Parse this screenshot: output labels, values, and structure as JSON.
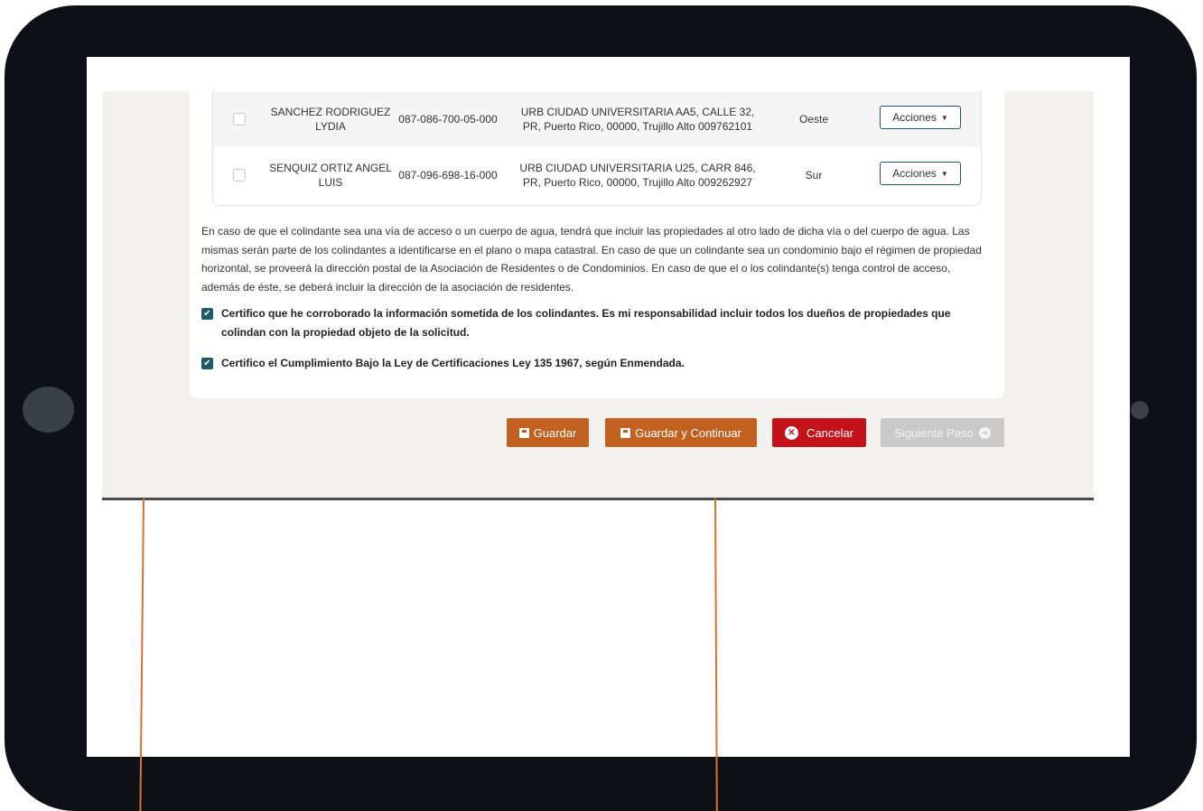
{
  "table": {
    "rows": [
      {
        "name": "SANCHEZ RODRIGUEZ LYDIA",
        "number": "087-086-700-05-000",
        "address": "URB CIUDAD UNIVERSITARIA AA5, CALLE 32, PR, Puerto Rico, 00000, Trujillo Alto 009762101",
        "direction": "Oeste",
        "actions_label": "Acciones"
      },
      {
        "name": "SENQUIZ ORTIZ ANGEL LUIS",
        "number": "087-096-698-16-000",
        "address": "URB CIUDAD UNIVERSITARIA U25, CARR 846, PR, Puerto Rico, 00000, Trujillo Alto 009262927",
        "direction": "Sur",
        "actions_label": "Acciones"
      }
    ]
  },
  "notice": "En caso de que el colindante sea una vía de acceso o un cuerpo de agua, tendrá que incluir las propiedades al otro lado de dicha vía o del cuerpo de agua. Las mismas serán parte de los colindantes a identificarse en el plano o mapa catastral. En caso de que un colindante sea un condominio bajo el régimen de propiedad horizontal, se proveerá la dirección postal de la Asociación de Residentes o de Condominios. En caso de que el o los colindante(s) tenga control de acceso, además de éste, se deberá incluir la dirección de la asociación de residentes.",
  "certifications": [
    {
      "text": "Certifico que he corroborado la información sometida de los colindantes. Es mi responsabilidad incluir todos los dueños de propiedades que colindan con la propiedad objeto de la solicitud.",
      "checked": true
    },
    {
      "text": "Certifico el Cumplimiento Bajo la Ley de Certificaciones Ley 135 1967, según Enmendada.",
      "checked": true
    }
  ],
  "buttons": {
    "guardar": "Guardar",
    "guardar_continuar": "Guardar y Continuar",
    "cancelar": "Cancelar",
    "siguiente": "Siguiente Paso"
  },
  "colors": {
    "primary_orange": "#c2611f",
    "danger_red": "#c4121a",
    "disabled_gray": "#c9c9c9",
    "checkbox_teal": "#1e5a68",
    "tablet_frame": "#0d1117",
    "pointer_line": "#d9722b"
  }
}
